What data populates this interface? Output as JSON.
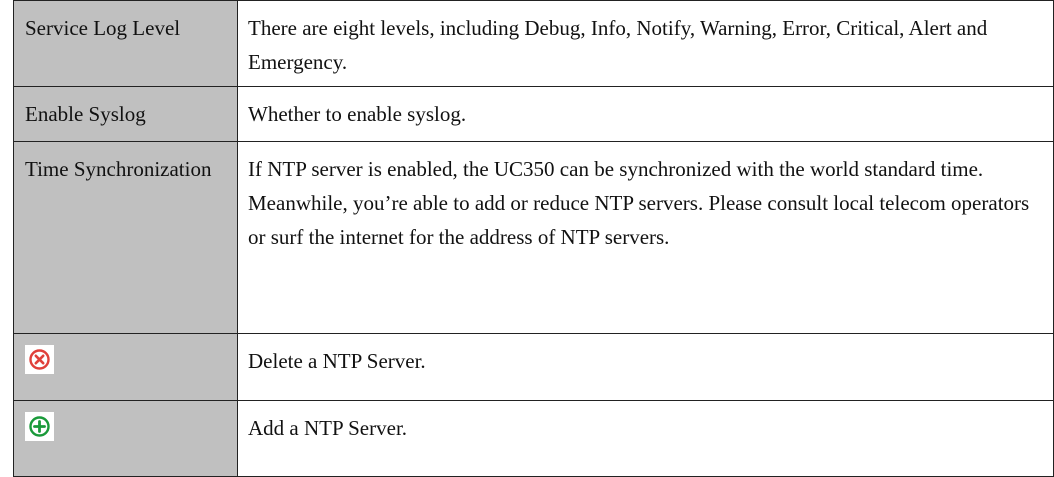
{
  "rows": [
    {
      "name": "Service Log Level",
      "description": "There are eight levels, including Debug, Info, Notify, Warning, Error, Critical, Alert and Emergency."
    },
    {
      "name": "Enable Syslog",
      "description": "Whether to enable syslog."
    },
    {
      "name": "Time Synchronization",
      "description": "If NTP server is enabled, the UC350 can be synchronized with the world standard time. Meanwhile, you’re able to add or reduce NTP servers. Please consult local telecom operators or surf the internet for the address of NTP servers."
    },
    {
      "icon": "delete-icon",
      "icon_color": "#e0403a",
      "description": "Delete a NTP Server."
    },
    {
      "icon": "add-icon",
      "icon_color": "#1a9a3a",
      "description": "Add a NTP Server."
    }
  ],
  "colors": {
    "name_cell_bg": "#c0c0c0",
    "border": "#222222"
  }
}
